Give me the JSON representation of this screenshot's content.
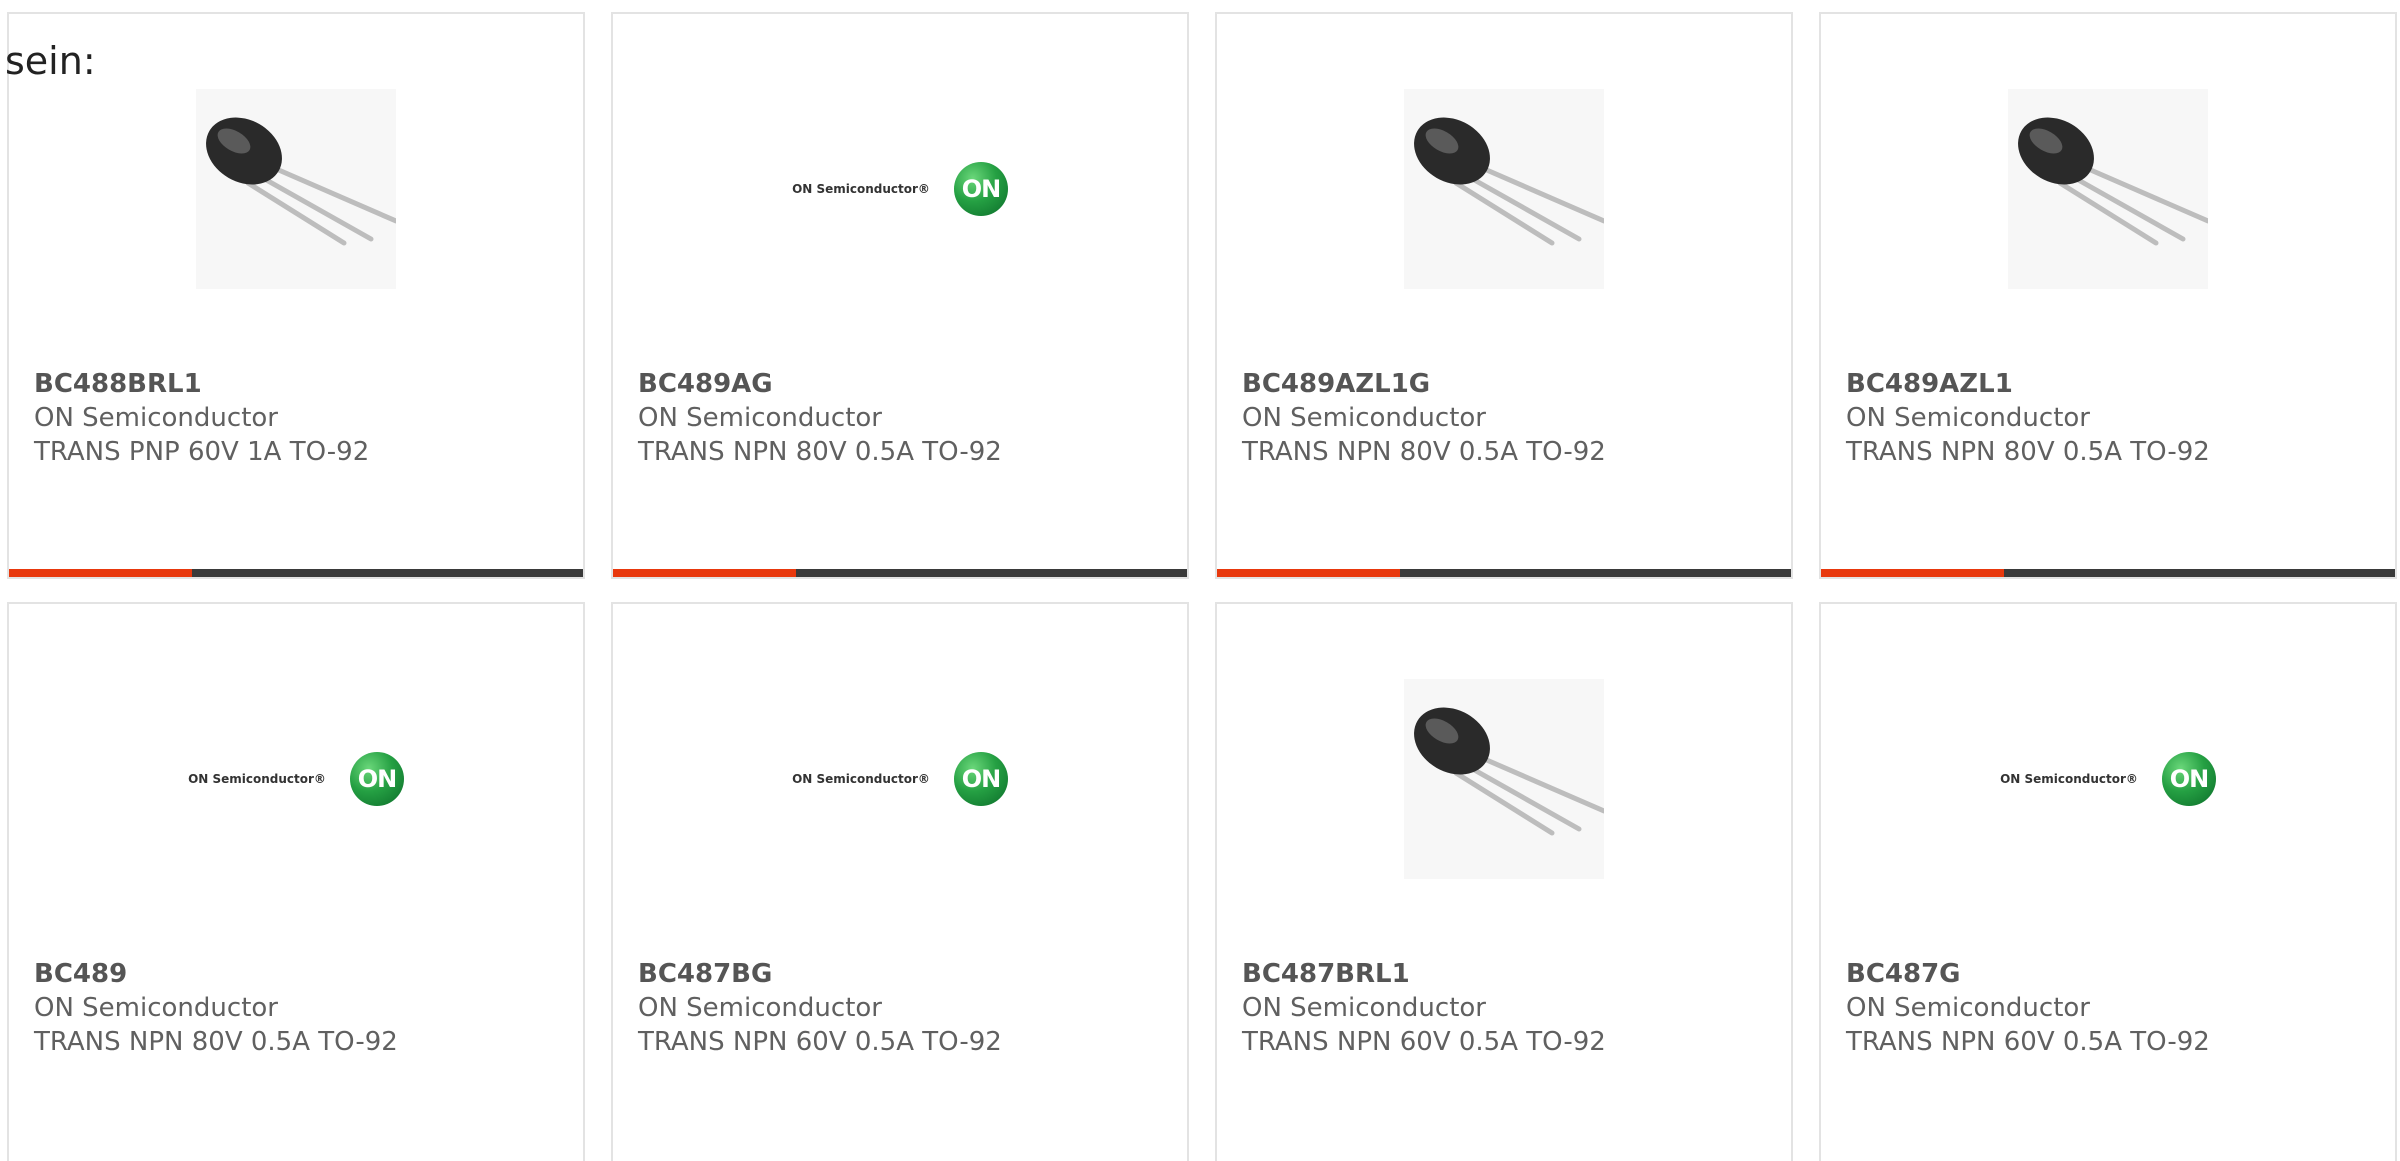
{
  "intro_text": "sein:",
  "cards": [
    {
      "part": "BC488BRL1",
      "maker": "ON Semiconductor",
      "desc": "TRANS PNP 60V 1A TO-92",
      "image": "transistor-photo"
    },
    {
      "part": "BC489AG",
      "maker": "ON Semiconductor",
      "desc": "TRANS NPN 80V 0.5A TO-92",
      "image": "on-semi-logo"
    },
    {
      "part": "BC489AZL1G",
      "maker": "ON Semiconductor",
      "desc": "TRANS NPN 80V 0.5A TO-92",
      "image": "transistor-photo"
    },
    {
      "part": "BC489AZL1",
      "maker": "ON Semiconductor",
      "desc": "TRANS NPN 80V 0.5A TO-92",
      "image": "transistor-photo"
    },
    {
      "part": "BC489",
      "maker": "ON Semiconductor",
      "desc": "TRANS NPN 80V 0.5A TO-92",
      "image": "on-semi-logo"
    },
    {
      "part": "BC487BG",
      "maker": "ON Semiconductor",
      "desc": "TRANS NPN 60V 0.5A TO-92",
      "image": "on-semi-logo"
    },
    {
      "part": "BC487BRL1",
      "maker": "ON Semiconductor",
      "desc": "TRANS NPN 60V 0.5A TO-92",
      "image": "transistor-photo"
    },
    {
      "part": "BC487G",
      "maker": "ON Semiconductor",
      "desc": "TRANS NPN 60V 0.5A TO-92",
      "image": "on-semi-logo"
    }
  ],
  "logo": {
    "text": "ON Semiconductor®",
    "badge": "ON"
  },
  "colors": {
    "accent": "#e8380d",
    "bar": "#3a3a3a",
    "border": "#e3e3e3",
    "logo_green": "#25a043"
  }
}
